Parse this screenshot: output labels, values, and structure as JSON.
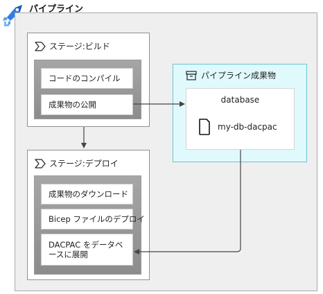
{
  "pipeline": {
    "title": "パイプライン"
  },
  "stages": {
    "build": {
      "title": "ステージ:ビルド",
      "tasks": [
        "コードのコンパイル",
        "成果物の公開"
      ]
    },
    "deploy": {
      "title": "ステージ:デプロイ",
      "tasks": [
        "成果物のダウンロード",
        "Bicep ファイルのデプロイ",
        "DACPAC をデータベースに展開"
      ]
    }
  },
  "artifacts": {
    "title": "パイプライン成果物",
    "folder": "database",
    "file": "my-db-dacpac"
  },
  "colors": {
    "logo_blue": "#2f7de1",
    "artifact_bg": "#e0f9fd",
    "artifact_border": "#67c3d6",
    "connector": "#444444"
  },
  "icons": {
    "pipeline": "azure-pipelines-icon",
    "stage": "chevron-stage-icon",
    "artifact": "archive-box-icon",
    "file": "file-icon"
  }
}
